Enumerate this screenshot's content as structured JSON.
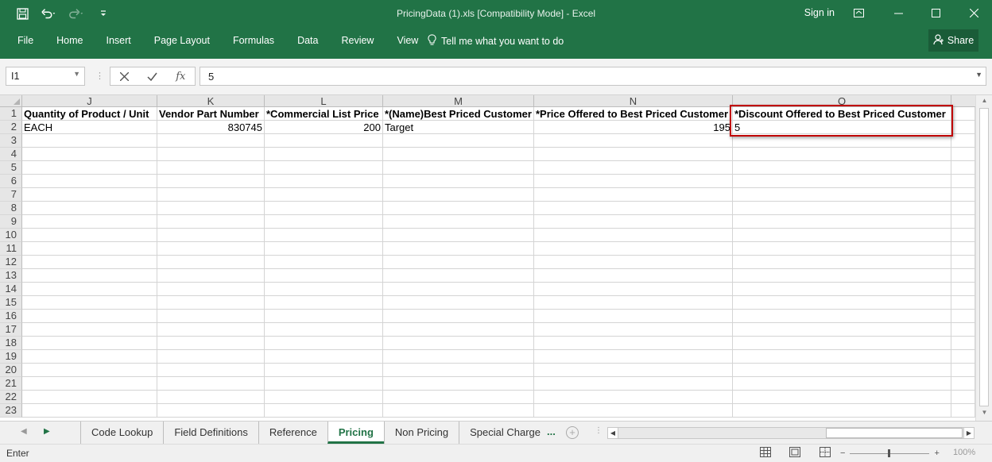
{
  "window": {
    "title": "PricingData (1).xls  [Compatibility Mode] - Excel",
    "sign_in": "Sign in"
  },
  "quick_access": {
    "icons": [
      "save-icon",
      "undo-icon",
      "redo-icon",
      "customize-icon"
    ]
  },
  "ribbon": {
    "tabs": [
      "File",
      "Home",
      "Insert",
      "Page Layout",
      "Formulas",
      "Data",
      "Review",
      "View"
    ],
    "tell_me": "Tell me what you want to do",
    "share": "Share"
  },
  "formula_bar": {
    "name_box": "I1",
    "fx": "fx",
    "value": "5"
  },
  "grid": {
    "columns": [
      "J",
      "K",
      "L",
      "M",
      "N",
      "O"
    ],
    "rows": [
      "1",
      "2",
      "3",
      "4",
      "5",
      "6",
      "7",
      "8",
      "9",
      "10",
      "11",
      "12",
      "13",
      "14",
      "15",
      "16",
      "17",
      "18",
      "19",
      "20",
      "21",
      "22",
      "23"
    ],
    "header_row": [
      "Quantity of Product / Unit",
      "Vendor Part Number",
      "*Commercial List Price",
      "*(Name)Best Priced Customer",
      "*Price Offered to Best Priced Customer",
      "*Discount Offered to Best Priced Customer"
    ],
    "data_row": [
      "EACH",
      "830745",
      "200",
      "Target",
      "195",
      "5"
    ]
  },
  "sheet_tabs": {
    "tabs": [
      "Code Lookup",
      "Field Definitions",
      "Reference",
      "Pricing",
      "Non Pricing",
      "Special Charge"
    ],
    "active": "Pricing",
    "more": "..."
  },
  "status_bar": {
    "mode": "Enter",
    "zoom": "100%"
  },
  "colors": {
    "brand": "#217346",
    "highlight": "#c00000"
  }
}
